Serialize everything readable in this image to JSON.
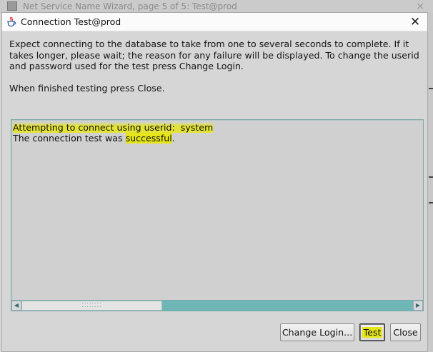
{
  "background_window": {
    "title": "Net Service Name Wizard, page 5 of 5: Test@prod",
    "close_glyph": "×"
  },
  "dialog": {
    "title": "Connection Test@prod",
    "close_glyph": "✕",
    "instructions": "Expect connecting to the database to take from one to several seconds to complete. If it takes longer, please wait; the reason for any failure will be displayed. To change the userid and password used for the test press Change Login.",
    "finish_text": "When finished testing press Close.",
    "output": {
      "line1_a": "Attempting to connect using userid:  system",
      "line2_a": "The connection test was ",
      "line2_b": "successful",
      "line2_c": "."
    },
    "scrollbar": {
      "left_arrow": "◀",
      "right_arrow": "▶",
      "grip": "⁚⁚⁚⁚⁚⁚⁚⁚"
    },
    "buttons": {
      "change_login": "Change Login...",
      "test": "Test",
      "close": "Close"
    }
  },
  "colors": {
    "highlight": "#e5e51a",
    "scroll_track": "#6fb6b6"
  }
}
